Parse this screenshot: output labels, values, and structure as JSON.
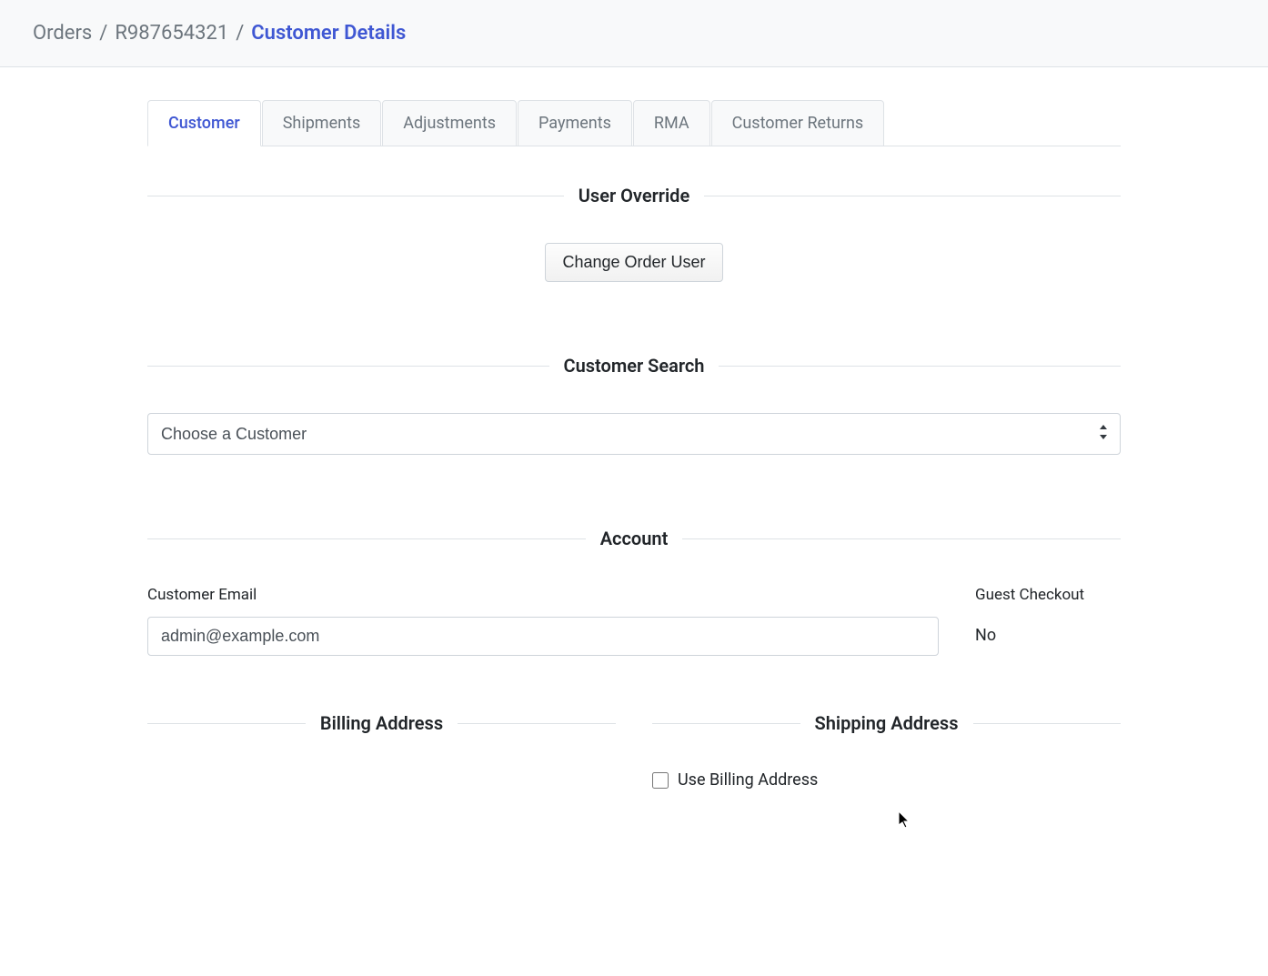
{
  "breadcrumb": {
    "items": [
      {
        "label": "Orders"
      },
      {
        "label": "R987654321"
      }
    ],
    "current": "Customer Details"
  },
  "tabs": [
    {
      "label": "Customer",
      "active": true
    },
    {
      "label": "Shipments",
      "active": false
    },
    {
      "label": "Adjustments",
      "active": false
    },
    {
      "label": "Payments",
      "active": false
    },
    {
      "label": "RMA",
      "active": false
    },
    {
      "label": "Customer Returns",
      "active": false
    }
  ],
  "sections": {
    "user_override": {
      "legend": "User Override",
      "change_user_label": "Change Order User"
    },
    "customer_search": {
      "legend": "Customer Search",
      "placeholder": "Choose a Customer"
    },
    "account": {
      "legend": "Account",
      "email_label": "Customer Email",
      "email_value": "admin@example.com",
      "guest_label": "Guest Checkout",
      "guest_value": "No"
    },
    "billing": {
      "legend": "Billing Address"
    },
    "shipping": {
      "legend": "Shipping Address",
      "use_billing_label": "Use Billing Address"
    }
  }
}
